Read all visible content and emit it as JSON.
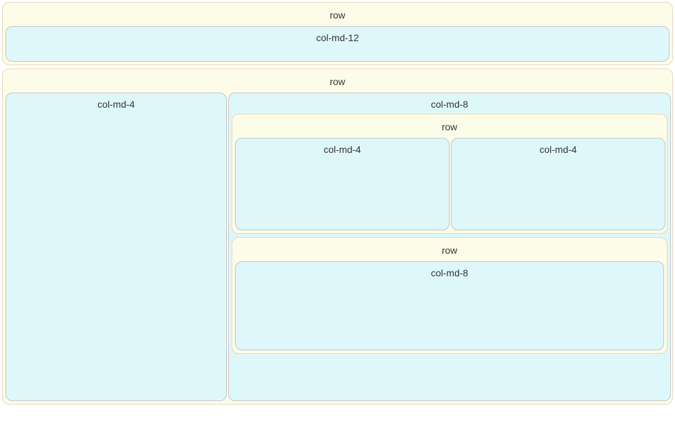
{
  "row1": {
    "label": "row",
    "col1": {
      "label": "col-md-12"
    }
  },
  "row2": {
    "label": "row",
    "colA": {
      "label": "col-md-4"
    },
    "colB": {
      "label": "col-md-8",
      "nested_row1": {
        "label": "row",
        "c1": {
          "label": "col-md-4"
        },
        "c2": {
          "label": "col-md-4"
        }
      },
      "nested_row2": {
        "label": "row",
        "c1": {
          "label": "col-md-8"
        }
      }
    }
  }
}
